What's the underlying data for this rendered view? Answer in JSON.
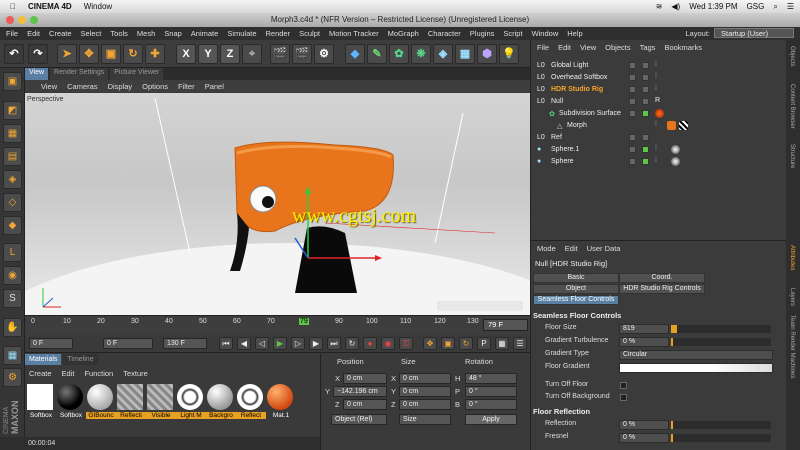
{
  "mac_menu": {
    "app": "CINEMA 4D",
    "window": "Window",
    "clock": "Wed 1:39 PM",
    "user": "GSG"
  },
  "window_title": "Morph3.c4d * (NFR Version – Restricted License) (Unregistered License)",
  "menu": [
    "File",
    "Edit",
    "Create",
    "Select",
    "Tools",
    "Mesh",
    "Snap",
    "Animate",
    "Simulate",
    "Render",
    "Sculpt",
    "Motion Tracker",
    "MoGraph",
    "Character",
    "Plugins",
    "Script",
    "Window",
    "Help"
  ],
  "layout": {
    "label": "Layout:",
    "value": "Startup (User)"
  },
  "toolbar": {
    "x": "X",
    "y": "Y",
    "z": "Z"
  },
  "viewport": {
    "tabs": [
      "View",
      "Render Settings",
      "Picture Viewer"
    ],
    "menu": [
      "View",
      "Cameras",
      "Display",
      "Options",
      "Filter",
      "Panel"
    ],
    "label": "Perspective",
    "watermark": "www.cgtsj.com"
  },
  "timeline": {
    "ticks": [
      "0",
      "10",
      "20",
      "30",
      "40",
      "50",
      "60",
      "70",
      "79",
      "90",
      "100",
      "110",
      "120",
      "130"
    ],
    "current_frame": "79 F",
    "start": "0 F",
    "min": "0 F",
    "max": "130 F"
  },
  "materials": {
    "tabs": [
      "Materials",
      "Timeline"
    ],
    "menu": [
      "Create",
      "Edit",
      "Function",
      "Texture"
    ],
    "items": [
      {
        "label": "Softbox"
      },
      {
        "label": "Softbox"
      },
      {
        "label": "GIBounc"
      },
      {
        "label": "Reflecti"
      },
      {
        "label": "Visible"
      },
      {
        "label": "Light M"
      },
      {
        "label": "Backgro"
      },
      {
        "label": "Reflect"
      },
      {
        "label": "Mat.1"
      }
    ],
    "status_time": "00:00:04"
  },
  "coords": {
    "headers": [
      "Position",
      "Size",
      "Rotation"
    ],
    "rows": [
      {
        "axis": "X",
        "pos": "0 cm",
        "saxis": "X",
        "size": "0 cm",
        "raxis": "H",
        "rot": "48 °"
      },
      {
        "axis": "Y",
        "pos": "−142.196 cm",
        "saxis": "Y",
        "size": "0 cm",
        "raxis": "P",
        "rot": "0 °"
      },
      {
        "axis": "Z",
        "pos": "0 cm",
        "saxis": "Z",
        "size": "0 cm",
        "raxis": "B",
        "rot": "0 °"
      }
    ],
    "mode": "Object (Rel)",
    "size_mode": "Size",
    "apply": "Apply"
  },
  "objects": {
    "menu": [
      "File",
      "Edit",
      "View",
      "Objects",
      "Tags",
      "Bookmarks"
    ],
    "items": [
      {
        "name": "Global Light",
        "indent": 0,
        "color": "#ffffff"
      },
      {
        "name": "Overhead Softbox",
        "indent": 0,
        "color": "#ffffff"
      },
      {
        "name": "HDR Studio Rig",
        "indent": 0,
        "color": "#f5a52a"
      },
      {
        "name": "Null",
        "indent": 0,
        "color": "#ffffff"
      },
      {
        "name": "Subdivision Surface",
        "indent": 1,
        "color": "#ffffff"
      },
      {
        "name": "Morph",
        "indent": 2,
        "color": "#ffffff"
      },
      {
        "name": "Ref",
        "indent": 0,
        "color": "#ffffff"
      },
      {
        "name": "Sphere.1",
        "indent": 0,
        "color": "#ffffff"
      },
      {
        "name": "Sphere",
        "indent": 0,
        "color": "#ffffff"
      }
    ]
  },
  "attributes": {
    "menu": [
      "Mode",
      "Edit",
      "User Data"
    ],
    "title": "Null [HDR Studio Rig]",
    "tabs": [
      "Basic",
      "Coord.",
      "Object",
      "HDR Studio Rig Controls",
      "Seamless Floor Controls"
    ],
    "section1": "Seamless Floor Controls",
    "rows": [
      {
        "label": "Floor Size",
        "value": "819"
      },
      {
        "label": "Gradient Turbulence",
        "value": "0 %"
      },
      {
        "label": "Gradient Type",
        "value": "Circular"
      },
      {
        "label": "Floor Gradient",
        "value": ""
      },
      {
        "label": "Turn Off Floor",
        "value": ""
      },
      {
        "label": "Turn Off Background",
        "value": ""
      }
    ],
    "section2": "Floor Reflection",
    "rows2": [
      {
        "label": "Reflection",
        "value": "0 %"
      },
      {
        "label": "Fresnel",
        "value": "0 %"
      }
    ]
  },
  "right_tabs": [
    "Objects",
    "Content Browser",
    "Structure",
    "Attributes",
    "Layers",
    "Team Render Machines"
  ]
}
